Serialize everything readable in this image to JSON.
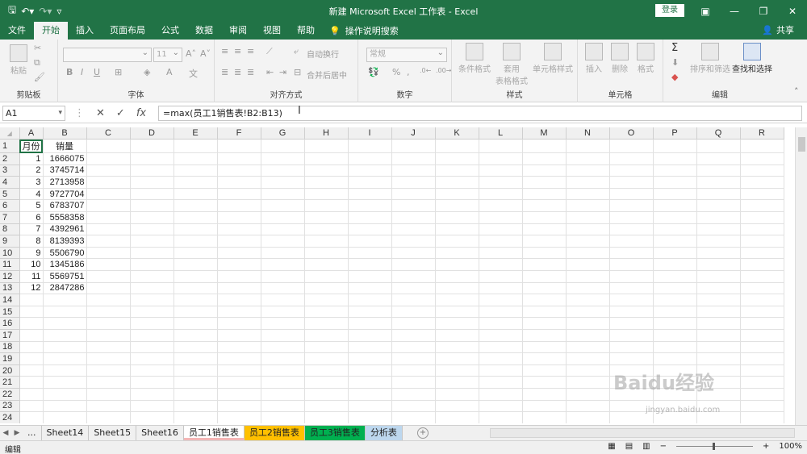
{
  "window": {
    "title": "新建 Microsoft Excel 工作表  -  Excel",
    "login": "登录"
  },
  "tabs": [
    "文件",
    "开始",
    "插入",
    "页面布局",
    "公式",
    "数据",
    "审阅",
    "视图",
    "帮助"
  ],
  "tell_me": "操作说明搜索",
  "share": "共享",
  "ribbon": {
    "paste": "粘贴",
    "clipboard": "剪贴板",
    "font_group": "字体",
    "font_size": "11",
    "align_group": "对齐方式",
    "wrap_text": "自动换行",
    "merge_center": "合并后居中",
    "number_group": "数字",
    "number_format": "常规",
    "styles_group": "样式",
    "conditional_format": "条件格式",
    "table_format_1": "套用",
    "table_format_2": "表格格式",
    "cell_styles": "单元格样式",
    "cells_group": "单元格",
    "insert": "插入",
    "delete": "删除",
    "format": "格式",
    "editing_group": "编辑",
    "sort_filter": "排序和筛选",
    "find_select": "查找和选择"
  },
  "formula_bar": {
    "name_box": "A1",
    "formula": "=max(员工1销售表!B2:B13)"
  },
  "grid": {
    "columns": [
      "A",
      "B",
      "C",
      "D",
      "E",
      "F",
      "G",
      "H",
      "I",
      "J",
      "K",
      "L",
      "M",
      "N",
      "O",
      "P",
      "Q",
      "R"
    ],
    "header_row": [
      "月份",
      "销量"
    ],
    "data": [
      [
        "1",
        "1666075"
      ],
      [
        "2",
        "3745714"
      ],
      [
        "3",
        "2713958"
      ],
      [
        "4",
        "9727704"
      ],
      [
        "5",
        "6783707"
      ],
      [
        "6",
        "5558358"
      ],
      [
        "7",
        "4392961"
      ],
      [
        "8",
        "8139393"
      ],
      [
        "9",
        "5506790"
      ],
      [
        "10",
        "1345186"
      ],
      [
        "11",
        "5569751"
      ],
      [
        "12",
        "2847286"
      ]
    ],
    "total_rows": 24
  },
  "sheets": [
    "...",
    "Sheet14",
    "Sheet15",
    "Sheet16",
    "员工1销售表",
    "员工2销售表",
    "员工3销售表",
    "分析表"
  ],
  "sheet_colors": {
    "员工1销售表": "#f4b6b6",
    "员工2销售表": "#ffc000",
    "员工3销售表": "#00b050",
    "分析表": "#bdd7ee"
  },
  "active_sheet": "员工1销售表",
  "status": {
    "mode": "编辑",
    "zoom": "100%"
  },
  "watermark": {
    "logo": "Baidu经验",
    "url": "jingyan.baidu.com"
  }
}
